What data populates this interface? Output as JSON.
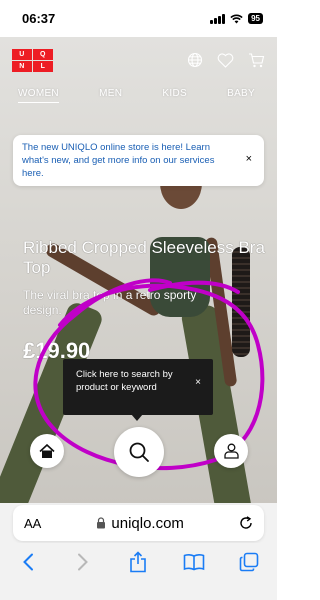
{
  "status": {
    "time": "06:37",
    "battery": "95"
  },
  "brand": {
    "logo_top": "UNI",
    "logo_bottom": "QLO",
    "logo_chars": [
      "U",
      "N",
      "I",
      "Q",
      "L",
      "O"
    ],
    "accent": "#ed1d24"
  },
  "tabs": [
    {
      "label": "WOMEN",
      "active": true
    },
    {
      "label": "MEN",
      "active": false
    },
    {
      "label": "KIDS",
      "active": false
    },
    {
      "label": "BABY",
      "active": false
    }
  ],
  "notice": {
    "text": "The new UNIQLO online store is here! Learn what's new, and get more info on our services here.",
    "close": "×",
    "color": "#1a5fb4"
  },
  "product": {
    "title": "Ribbed Cropped Sleeveless Bra Top",
    "subtitle": "The viral bra top in a retro sporty design.",
    "price": "£19.90"
  },
  "tooltip": {
    "text": "Click here to search by product or keyword",
    "close": "×"
  },
  "browser": {
    "text_size_label": "AA",
    "url": "uniqlo.com"
  },
  "icons": {
    "header": [
      "globe-icon",
      "heart-icon",
      "cart-icon"
    ],
    "fabs": [
      "home-icon",
      "search-icon",
      "account-icon"
    ],
    "toolbar": [
      "back-icon",
      "forward-icon",
      "share-icon",
      "bookmarks-icon",
      "tabs-icon"
    ]
  },
  "annotation_color": "#c000c8"
}
